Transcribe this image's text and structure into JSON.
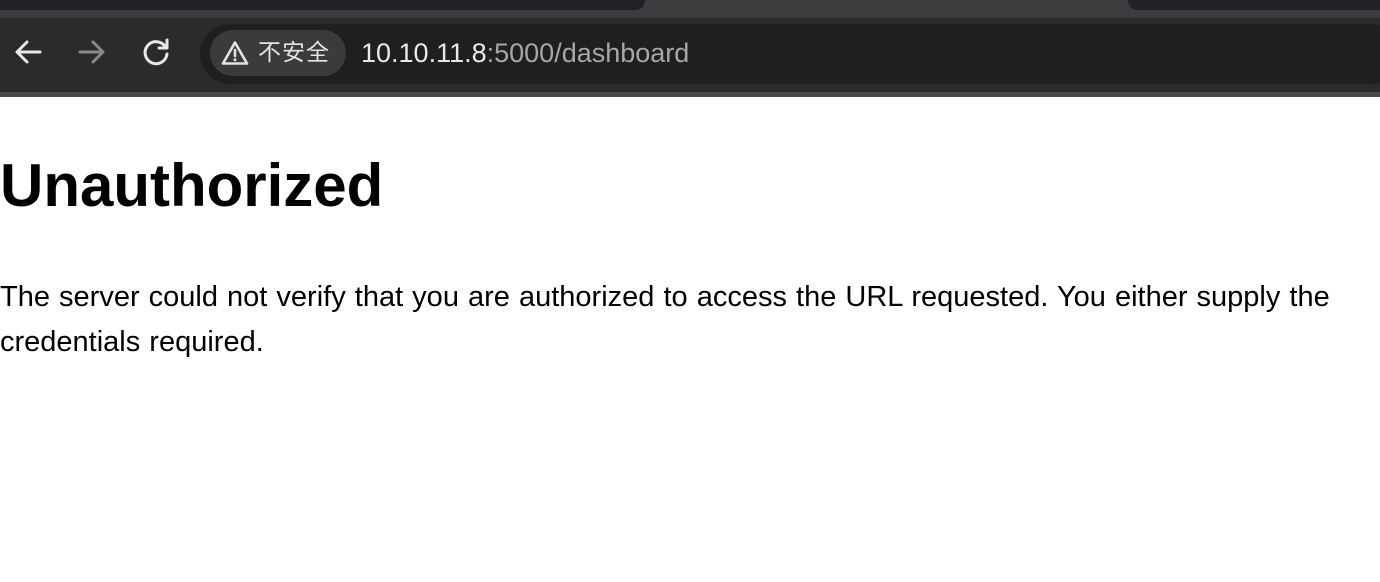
{
  "browser": {
    "nav": {
      "back_icon": "arrow-left-icon",
      "forward_icon": "arrow-right-icon",
      "reload_icon": "reload-icon"
    },
    "security_chip": {
      "icon": "warning-triangle-icon",
      "label": "不安全"
    },
    "address": {
      "host": "10.10.11.8",
      "path": ":5000/dashboard"
    },
    "colors": {
      "toolbar": "#2b2b2b",
      "omnibox": "#1f1f1f",
      "chip": "#3b3b3b"
    }
  },
  "page": {
    "heading": "Unauthorized",
    "message": "The server could not verify that you are authorized to access the URL requested. You either supply the credentials required."
  }
}
